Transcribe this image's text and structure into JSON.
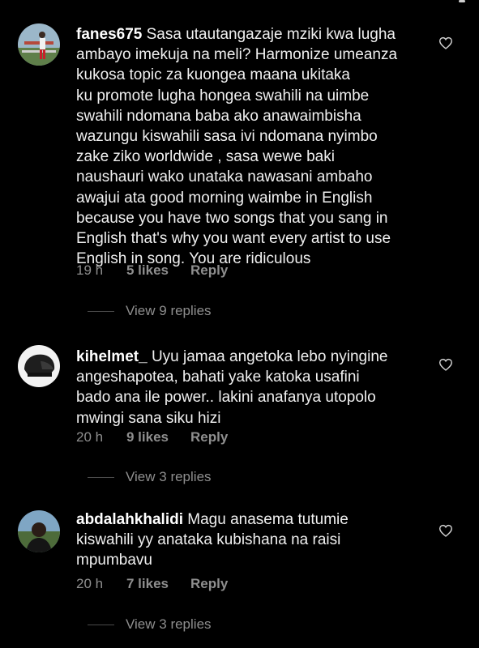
{
  "comments": [
    {
      "username": "fanes675",
      "text": "Sasa utautangazaje mziki kwa lugha\nambayo imekuja na meli? Harmonize umeanza\nkukosa topic za kuongea maana ukitaka\nku promote lugha hongea swahili na uimbe\nswahili ndomana baba ako anawaimbisha\nwazungu kiswahili sasa ivi ndomana nyimbo\nzake ziko  worldwide , sasa wewe baki\nnaushauri wako unataka nawasani ambaho\nawajui ata good morning waimbe in English\nbecause you have two songs that you sang in\nEnglish that's why you want every artist to use\nEnglish in song. You are ridiculous",
      "time": "19 h",
      "likes": "5 likes",
      "reply": "Reply",
      "view_replies": "View 9 replies"
    },
    {
      "username": "kihelmet_",
      "text": "Uyu jamaa angetoka lebo nyingine\nangeshapotea, bahati yake katoka usafini\nbado ana ile power.. lakini anafanya utopolo\nmwingi sana siku hizi",
      "time": "20 h",
      "likes": "9 likes",
      "reply": "Reply",
      "view_replies": "View 3 replies"
    },
    {
      "username": "abdalahkhalidi",
      "text": "Magu anasema tutumie\nkiswahili yy anataka kubishana na raisi\nmpumbavu",
      "time": "20 h",
      "likes": "7 likes",
      "reply": "Reply",
      "view_replies": "View 3 replies"
    }
  ],
  "colors": {
    "background": "#000000",
    "text": "#f0f0f0",
    "secondary": "#8e8e8e"
  },
  "icons": {
    "like": "heart-outline-icon"
  }
}
